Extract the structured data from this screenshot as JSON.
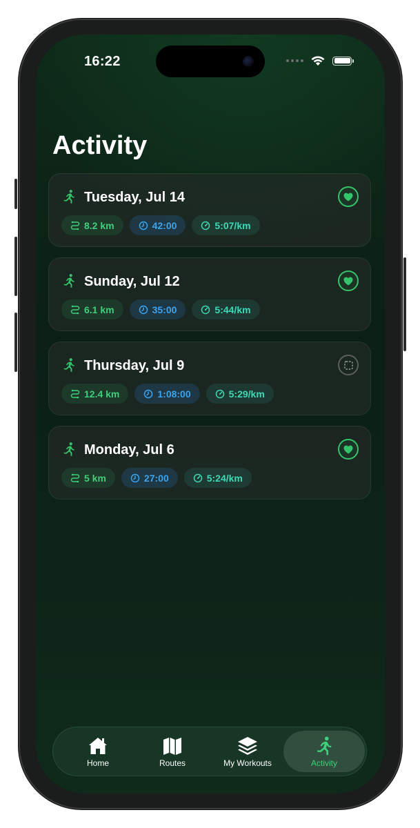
{
  "status_bar": {
    "time": "16:22"
  },
  "page": {
    "title": "Activity"
  },
  "activities": [
    {
      "title": "Tuesday, Jul 14",
      "distance": "8.2 km",
      "duration": "42:00",
      "pace": "5:07/km",
      "favorited": true
    },
    {
      "title": "Sunday, Jul 12",
      "distance": "6.1 km",
      "duration": "35:00",
      "pace": "5:44/km",
      "favorited": true
    },
    {
      "title": "Thursday, Jul 9",
      "distance": "12.4 km",
      "duration": "1:08:00",
      "pace": "5:29/km",
      "favorited": false
    },
    {
      "title": "Monday, Jul 6",
      "distance": "5 km",
      "duration": "27:00",
      "pace": "5:24/km",
      "favorited": true
    }
  ],
  "tab_bar": {
    "home": "Home",
    "routes": "Routes",
    "workouts": "My Workouts",
    "activity": "Activity",
    "active_tab": "activity"
  },
  "colors": {
    "accent_green": "#34c46a",
    "distance_chip": "#3ed07a",
    "time_chip": "#3aa4f0",
    "pace_chip": "#3fd8b6"
  },
  "icons": {
    "run": "runner-icon",
    "favorite_on": "heart-icon",
    "favorite_off": "dashed-square-icon",
    "distance": "route-icon",
    "duration": "clock-icon",
    "pace": "speedometer-icon"
  }
}
